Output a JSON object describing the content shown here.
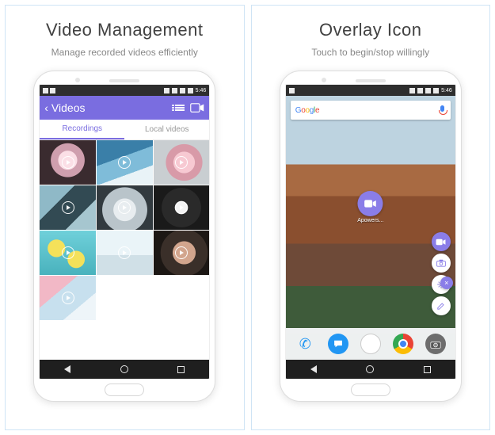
{
  "left": {
    "title": "Video Management",
    "subtitle": "Manage recorded videos efficiently",
    "header": {
      "back": "Videos"
    },
    "tabs": [
      "Recordings",
      "Local videos"
    ],
    "status_time": "5:46"
  },
  "right": {
    "title": "Overlay Icon",
    "subtitle": "Touch to begin/stop willingly",
    "app_label": "Apowers...",
    "status_time": "5:46",
    "fab_close": "×"
  },
  "nav": {
    "back": "◁",
    "home": "○",
    "recent": "□"
  }
}
